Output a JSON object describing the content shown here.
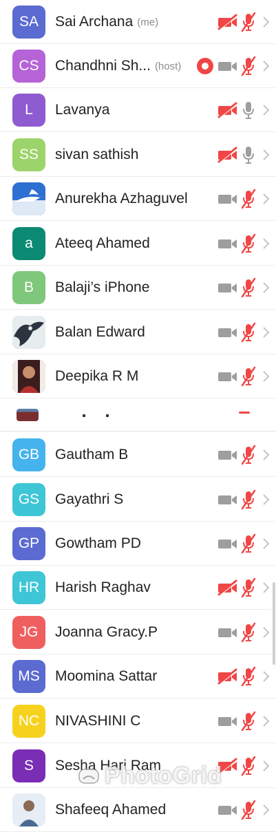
{
  "participants": [
    {
      "initials": "SA",
      "name": "Sai Archana",
      "tag": "(me)",
      "avatar_color": "#5b6bd1",
      "cam": "off",
      "mic": "muted",
      "record": false
    },
    {
      "initials": "CS",
      "name": "Chandhni Sh...",
      "tag": "(host)",
      "avatar_color": "#b563d6",
      "cam": "on",
      "mic": "muted",
      "record": true
    },
    {
      "initials": "L",
      "name": "Lavanya",
      "tag": "",
      "avatar_color": "#8f5bd0",
      "cam": "off",
      "mic": "on",
      "record": false
    },
    {
      "initials": "SS",
      "name": "sivan sathish",
      "tag": "",
      "avatar_color": "#9dd36b",
      "cam": "off",
      "mic": "on",
      "record": false
    },
    {
      "initials": "",
      "name": "Anurekha Azhaguvel",
      "tag": "",
      "avatar_color": "#2d6fd6",
      "avatar_image": "photo-sky",
      "cam": "on",
      "mic": "muted",
      "record": false
    },
    {
      "initials": "a",
      "name": "Ateeq Ahamed",
      "tag": "",
      "avatar_color": "#0c8a73",
      "cam": "on",
      "mic": "muted",
      "record": false
    },
    {
      "initials": "B",
      "name": "Balaji’s iPhone",
      "tag": "",
      "avatar_color": "#7fc77a",
      "cam": "on",
      "mic": "muted",
      "record": false
    },
    {
      "initials": "",
      "name": "Balan Edward",
      "tag": "",
      "avatar_color": "#3a4656",
      "avatar_image": "photo-eagle",
      "cam": "on",
      "mic": "muted",
      "record": false
    },
    {
      "initials": "",
      "name": "Deepika R M",
      "tag": "",
      "avatar_color": "#8a3a3a",
      "avatar_image": "photo-person",
      "cam": "on",
      "mic": "muted",
      "record": false
    },
    {
      "initials": "GB",
      "name": "Gautham B",
      "tag": "",
      "avatar_color": "#45b3ee",
      "cam": "on",
      "mic": "muted",
      "record": false
    },
    {
      "initials": "GS",
      "name": "Gayathri S",
      "tag": "",
      "avatar_color": "#3fc6d6",
      "cam": "on",
      "mic": "muted",
      "record": false
    },
    {
      "initials": "GP",
      "name": "Gowtham PD",
      "tag": "",
      "avatar_color": "#5b6bd1",
      "cam": "on",
      "mic": "muted",
      "record": false
    },
    {
      "initials": "HR",
      "name": "Harish Raghav",
      "tag": "",
      "avatar_color": "#3fc6d6",
      "cam": "off",
      "mic": "muted",
      "record": false
    },
    {
      "initials": "JG",
      "name": "Joanna Gracy.P",
      "tag": "",
      "avatar_color": "#ef5f5f",
      "cam": "on",
      "mic": "muted",
      "record": false
    },
    {
      "initials": "MS",
      "name": "Moomina Sattar",
      "tag": "",
      "avatar_color": "#5b6bd1",
      "cam": "off",
      "mic": "muted",
      "record": false
    },
    {
      "initials": "NC",
      "name": "NIVASHINI C",
      "tag": "",
      "avatar_color": "#f6d21f",
      "cam": "on",
      "mic": "muted",
      "record": false
    },
    {
      "initials": "S",
      "name": "Sesha Hari Ram",
      "tag": "",
      "avatar_color": "#7a2db5",
      "cam": "off",
      "mic": "muted",
      "record": false
    },
    {
      "initials": "",
      "name": "Shafeeq Ahamed",
      "tag": "",
      "avatar_color": "#cfd8e6",
      "avatar_image": "photo-person-light",
      "cam": "on",
      "mic": "muted",
      "record": false
    }
  ],
  "colors": {
    "muted_red": "#f04646",
    "icon_gray": "#9e9e9e",
    "chevron": "#c4c4c4",
    "record_red": "#f04646"
  },
  "watermark": {
    "text": "PhotoGrid"
  }
}
